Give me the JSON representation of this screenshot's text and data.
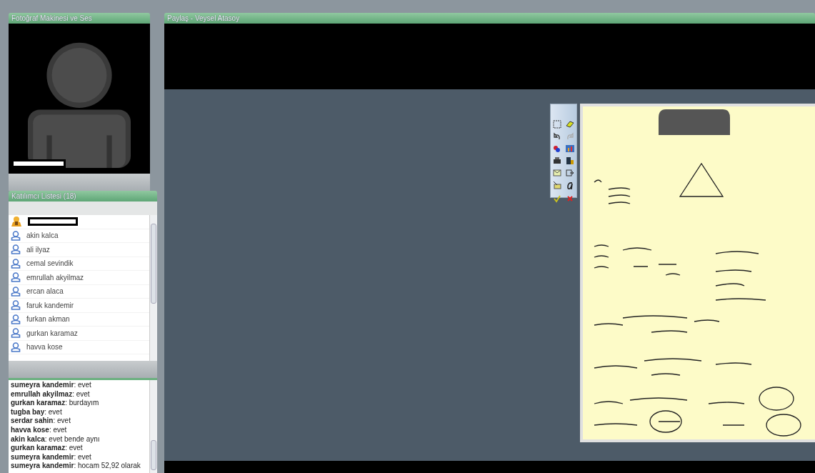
{
  "camera_pod": {
    "title": "Fotoğraf Makinesi ve Ses"
  },
  "participants_pod": {
    "title": "Katılımcı Listesi (18)",
    "items": [
      {
        "kind": "host"
      },
      {
        "kind": "guest",
        "name": "akin kalca"
      },
      {
        "kind": "guest",
        "name": "ali ilyaz"
      },
      {
        "kind": "guest",
        "name": "cemal sevindik"
      },
      {
        "kind": "guest",
        "name": "emrullah akyilmaz"
      },
      {
        "kind": "guest",
        "name": "ercan alaca"
      },
      {
        "kind": "guest",
        "name": "faruk kandemir"
      },
      {
        "kind": "guest",
        "name": "furkan akman"
      },
      {
        "kind": "guest",
        "name": "gurkan karamaz"
      },
      {
        "kind": "guest",
        "name": "havva kose"
      }
    ]
  },
  "chat_pod": {
    "messages": [
      "**sumeyra kandemir**: evet",
      "**emrullah akyilmaz**: evet",
      "**gurkan karamaz**: burdayım",
      "**tugba bay**: evet",
      "**serdar sahin**: evet",
      "**havva kose**: evet",
      "**akin kalca**: evet bende aynı",
      "**gurkan karamaz**: evet",
      "**sumeyra kandemir**: evet",
      "**sumeyra kandemir**: hocam 52,92 olarak"
    ]
  },
  "share_pod": {
    "title": "Paylaş - Veysel Atasoy"
  }
}
